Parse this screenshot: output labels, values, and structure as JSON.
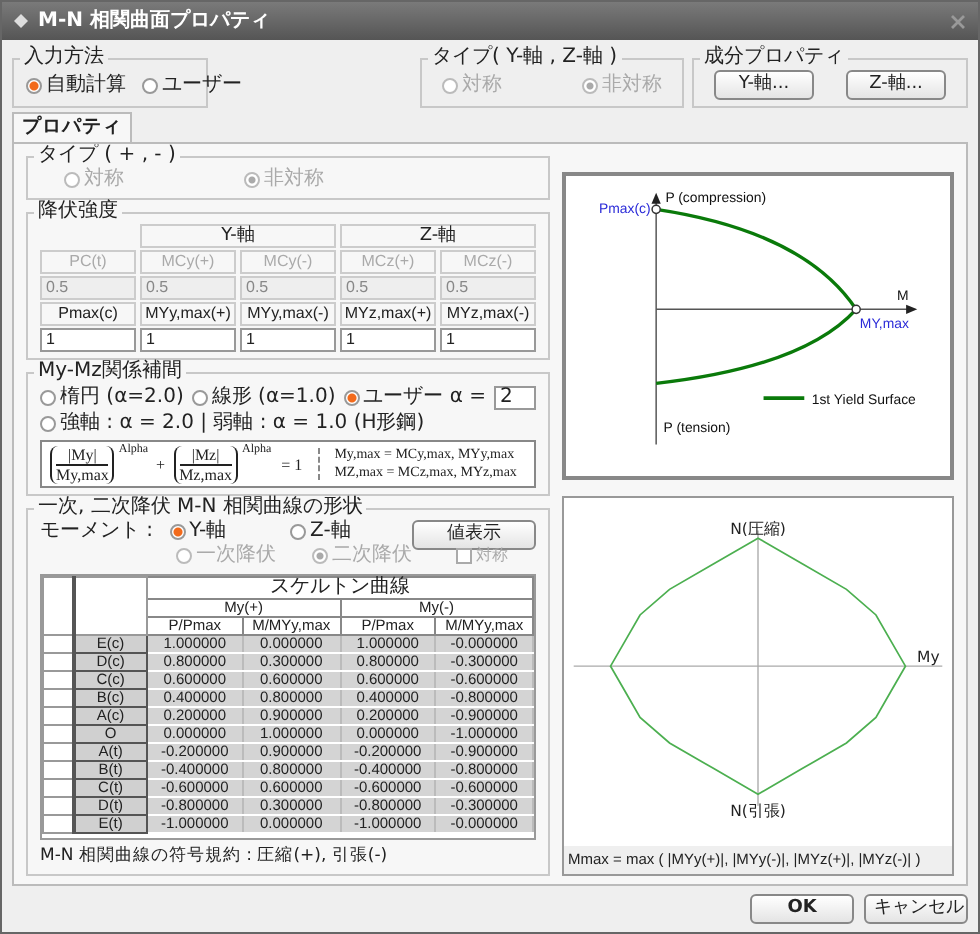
{
  "window": {
    "title": "M-N 相関曲面プロパティ"
  },
  "input_method": {
    "label": "入力方法",
    "options": [
      {
        "label": "自動計算",
        "selected": true
      },
      {
        "label": "ユーザー",
        "selected": false
      }
    ]
  },
  "type_yz": {
    "label": "タイプ( Y-軸 , Z-軸 )",
    "disabled": true,
    "options": [
      {
        "label": "対称",
        "selected": false
      },
      {
        "label": "非対称",
        "selected": true
      }
    ]
  },
  "component_property": {
    "label": "成分プロパティ",
    "buttons": [
      "Y-軸...",
      "Z-軸..."
    ]
  },
  "tabs": [
    {
      "label": "プロパティ",
      "selected": true
    }
  ],
  "type_pm": {
    "label": "タイプ ( + , - )",
    "disabled": true,
    "options": [
      {
        "label": "対称",
        "selected": false
      },
      {
        "label": "非対称",
        "selected": true
      }
    ]
  },
  "yield_strength": {
    "label": "降伏強度",
    "axis_headers": [
      "Y-軸",
      "Z-軸"
    ],
    "ratio_headers": [
      "PC(t)",
      "MCy(+)",
      "MCy(-)",
      "MCz(+)",
      "MCz(-)"
    ],
    "ratio_values": [
      "0.5",
      "0.5",
      "0.5",
      "0.5",
      "0.5"
    ],
    "max_headers": [
      "Pmax(c)",
      "MYy,max(+)",
      "MYy,max(-)",
      "MYz,max(+)",
      "MYz,max(-)"
    ],
    "max_values": [
      "1",
      "1",
      "1",
      "1",
      "1"
    ]
  },
  "interpolation": {
    "label": "My-Mz関係補間",
    "options": [
      {
        "label": "楕円 (α=2.0)",
        "selected": false
      },
      {
        "label": "線形 (α=1.0)",
        "selected": false
      },
      {
        "label": "ユーザー α =",
        "selected": true
      },
      {
        "label": "強軸 : α = 2.0 | 弱軸 : α = 1.0 (H形鋼)",
        "selected": false
      }
    ],
    "alpha": "2",
    "formula": {
      "terms": [
        {
          "num": "|My|",
          "den": "My,max",
          "exp": "Alpha"
        },
        {
          "num": "|Mz|",
          "den": "Mz,max",
          "exp": "Alpha"
        }
      ],
      "plus": "+",
      "rhs": "= 1",
      "notes": [
        "My,max = MCy,max, MYy,max",
        "MZ,max = MCz,max, MYz,max"
      ]
    }
  },
  "yield_chart": {
    "y_top": "P (compression)",
    "y_bottom": "P (tension)",
    "x_label": "M",
    "p_max": "Pmax(c)",
    "m_max": "MY,max",
    "legend": "1st Yield Surface"
  },
  "curve_shape": {
    "label": "一次, 二次降伏 M-N 相関曲線の形状",
    "moment_label": "モーメント :",
    "moment_options": [
      {
        "label": "Y-軸",
        "selected": true
      },
      {
        "label": "Z-軸",
        "selected": false
      }
    ],
    "yield_options": [
      {
        "label": "一次降伏",
        "selected": false
      },
      {
        "label": "二次降伏",
        "selected": true
      }
    ],
    "show_values_button": "値表示",
    "symmetric": {
      "label": "対称",
      "checked": false,
      "disabled": true
    },
    "table": {
      "title": "スケルトン曲線",
      "groups": [
        "My(+)",
        "My(-)"
      ],
      "columns": [
        "P/Pmax",
        "M/MYy,max",
        "P/Pmax",
        "M/MYy,max"
      ],
      "rows": [
        {
          "label": "E(c)",
          "values": [
            "1.000000",
            "0.000000",
            "1.000000",
            "-0.000000"
          ]
        },
        {
          "label": "D(c)",
          "values": [
            "0.800000",
            "0.300000",
            "0.800000",
            "-0.300000"
          ]
        },
        {
          "label": "C(c)",
          "values": [
            "0.600000",
            "0.600000",
            "0.600000",
            "-0.600000"
          ]
        },
        {
          "label": "B(c)",
          "values": [
            "0.400000",
            "0.800000",
            "0.400000",
            "-0.800000"
          ]
        },
        {
          "label": "A(c)",
          "values": [
            "0.200000",
            "0.900000",
            "0.200000",
            "-0.900000"
          ]
        },
        {
          "label": "O",
          "values": [
            "0.000000",
            "1.000000",
            "0.000000",
            "-1.000000"
          ]
        },
        {
          "label": "A(t)",
          "values": [
            "-0.200000",
            "0.900000",
            "-0.200000",
            "-0.900000"
          ]
        },
        {
          "label": "B(t)",
          "values": [
            "-0.400000",
            "0.800000",
            "-0.400000",
            "-0.800000"
          ]
        },
        {
          "label": "C(t)",
          "values": [
            "-0.600000",
            "0.600000",
            "-0.600000",
            "-0.600000"
          ]
        },
        {
          "label": "D(t)",
          "values": [
            "-0.800000",
            "0.300000",
            "-0.800000",
            "-0.300000"
          ]
        },
        {
          "label": "E(t)",
          "values": [
            "-1.000000",
            "0.000000",
            "-1.000000",
            "-0.000000"
          ]
        }
      ]
    },
    "note": "M-N 相関曲線の符号規約 : 圧縮(+), 引張(-)"
  },
  "interaction_chart": {
    "top": "N(圧縮)",
    "right": "My",
    "bottom": "N(引張)",
    "caption": "Mmax = max ( |MYy(+)|, |MYy(-)|, |MYz(+)|, |MYz(-)| )"
  },
  "buttons": [
    "OK",
    "キャンセル"
  ]
}
